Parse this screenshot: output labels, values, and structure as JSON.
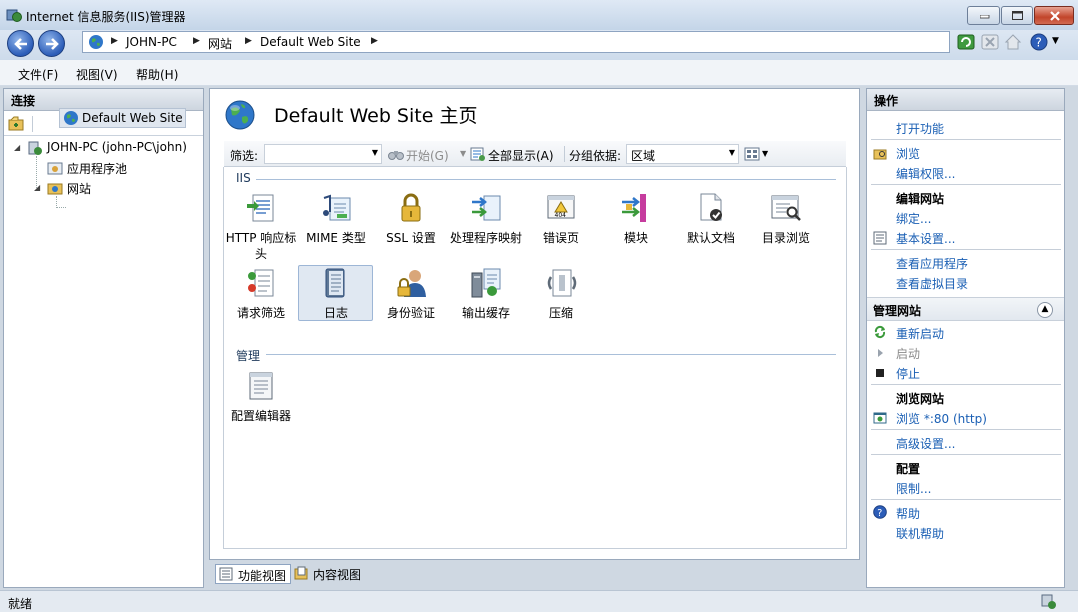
{
  "window": {
    "title": "Internet 信息服务(IIS)管理器"
  },
  "address": {
    "crumbs": [
      "JOHN-PC",
      "网站",
      "Default Web Site"
    ]
  },
  "menu": [
    "文件(F)",
    "视图(V)",
    "帮助(H)"
  ],
  "connections": {
    "header": "连接",
    "tree": {
      "server": "JOHN-PC (john-PC\\john)",
      "app_pools": "应用程序池",
      "sites": "网站",
      "site": "Default Web Site"
    }
  },
  "center": {
    "title": "Default Web Site 主页",
    "filter": {
      "label": "筛选:",
      "go": "开始(G)",
      "show_all": "全部显示(A)",
      "group_by_label": "分组依据:",
      "group_by_value": "区域"
    },
    "sections": {
      "iis": "IIS",
      "manage": "管理"
    },
    "features_row1": [
      "HTTP 响应标头",
      "MIME 类型",
      "SSL 设置",
      "处理程序映射",
      "错误页",
      "模块",
      "默认文档",
      "目录浏览"
    ],
    "features_row2": [
      "请求筛选",
      "日志",
      "身份验证",
      "输出缓存",
      "压缩"
    ],
    "manage_features": [
      "配置编辑器"
    ],
    "selected_feature": "日志"
  },
  "view_tabs": {
    "features": "功能视图",
    "content": "内容视图"
  },
  "actions": {
    "header": "操作",
    "open_feature": "打开功能",
    "explore": "浏览",
    "edit_permissions": "编辑权限...",
    "edit_site_head": "编辑网站",
    "bindings": "绑定...",
    "basic_settings": "基本设置...",
    "view_apps": "查看应用程序",
    "view_vdirs": "查看虚拟目录",
    "manage_site_head": "管理网站",
    "restart": "重新启动",
    "start": "启动",
    "stop": "停止",
    "browse_site_head": "浏览网站",
    "browse_80": "浏览 *:80 (http)",
    "advanced_settings": "高级设置...",
    "configure_head": "配置",
    "limits": "限制...",
    "help": "帮助",
    "online_help": "联机帮助"
  },
  "status": {
    "text": "就绪"
  },
  "colors": {
    "link": "#1a5fb4",
    "accent": "#2c5db8"
  }
}
